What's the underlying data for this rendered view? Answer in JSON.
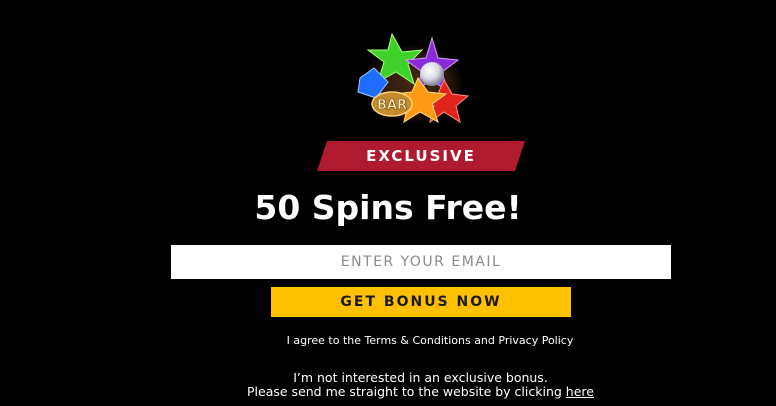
{
  "colors": {
    "background": "#000000",
    "badge": "#b01a2e",
    "cta": "#ffc000",
    "cta_text": "#1a1a1a",
    "input_bg": "#ffffff",
    "placeholder": "#8a8a8a",
    "text": "#ffffff"
  },
  "logo": {
    "icon": "starburst-gems-logo-icon",
    "text": "BAR"
  },
  "badge": {
    "label": "EXCLUSIVE"
  },
  "headline": "50 Spins Free!",
  "email": {
    "placeholder": "ENTER YOUR EMAIL",
    "value": ""
  },
  "cta": {
    "label": "GET BONUS NOW"
  },
  "consent": {
    "text": "I agree to the Terms & Conditions and Privacy Policy"
  },
  "decline": {
    "line1": "I’m not interested in an exclusive bonus.",
    "line2_prefix": "Please send me straight to the website by clicking ",
    "link_label": "here"
  }
}
